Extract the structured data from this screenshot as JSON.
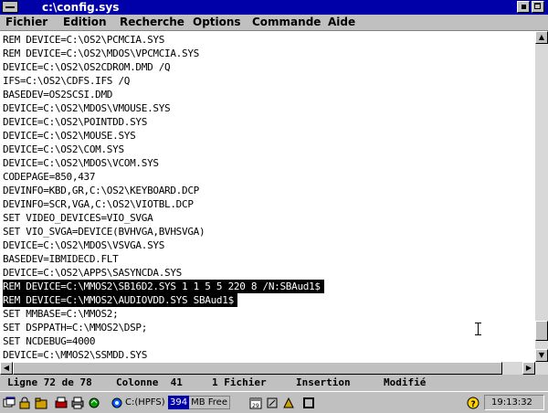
{
  "window": {
    "title": "c:\\config.sys"
  },
  "menubar": {
    "items": [
      {
        "label": "Fichier"
      },
      {
        "label": "Edition"
      },
      {
        "label": "Recherche"
      },
      {
        "label": "Options"
      },
      {
        "label": "Commande"
      },
      {
        "label": "Aide"
      }
    ]
  },
  "editor": {
    "lines": [
      {
        "text": "REM DEVICE=C:\\OS2\\PCMCIA.SYS",
        "selected": false
      },
      {
        "text": "REM DEVICE=C:\\OS2\\MDOS\\VPCMCIA.SYS",
        "selected": false
      },
      {
        "text": "DEVICE=C:\\OS2\\OS2CDROM.DMD /Q",
        "selected": false
      },
      {
        "text": "IFS=C:\\OS2\\CDFS.IFS /Q",
        "selected": false
      },
      {
        "text": "BASEDEV=OS2SCSI.DMD",
        "selected": false
      },
      {
        "text": "DEVICE=C:\\OS2\\MDOS\\VMOUSE.SYS",
        "selected": false
      },
      {
        "text": "DEVICE=C:\\OS2\\POINTDD.SYS",
        "selected": false
      },
      {
        "text": "DEVICE=C:\\OS2\\MOUSE.SYS",
        "selected": false
      },
      {
        "text": "DEVICE=C:\\OS2\\COM.SYS",
        "selected": false
      },
      {
        "text": "DEVICE=C:\\OS2\\MDOS\\VCOM.SYS",
        "selected": false
      },
      {
        "text": "CODEPAGE=850,437",
        "selected": false
      },
      {
        "text": "DEVINFO=KBD,GR,C:\\OS2\\KEYBOARD.DCP",
        "selected": false
      },
      {
        "text": "DEVINFO=SCR,VGA,C:\\OS2\\VIOTBL.DCP",
        "selected": false
      },
      {
        "text": "SET VIDEO_DEVICES=VIO_SVGA",
        "selected": false
      },
      {
        "text": "SET VIO_SVGA=DEVICE(BVHVGA,BVHSVGA)",
        "selected": false
      },
      {
        "text": "DEVICE=C:\\OS2\\MDOS\\VSVGA.SYS",
        "selected": false
      },
      {
        "text": "BASEDEV=IBMIDECD.FLT",
        "selected": false
      },
      {
        "text": "DEVICE=C:\\OS2\\APPS\\SASYNCDA.SYS",
        "selected": false
      },
      {
        "text": "REM DEVICE=C:\\MMOS2\\SB16D2.SYS 1 1 5 5 220 8 /N:SBAud1$",
        "selected": true
      },
      {
        "text": "REM DEVICE=C:\\MMOS2\\AUDIOVDD.SYS SBAud1$",
        "selected": true
      },
      {
        "text": "SET MMBASE=C:\\MMOS2;",
        "selected": false
      },
      {
        "text": "SET DSPPATH=C:\\MMOS2\\DSP;",
        "selected": false
      },
      {
        "text": "SET NCDEBUG=4000",
        "selected": false
      },
      {
        "text": "DEVICE=C:\\MMOS2\\SSMDD.SYS",
        "selected": false
      }
    ],
    "vscroll_position": 0.97,
    "hscroll_position": 0.0,
    "hscroll_visible_fraction": 0.96
  },
  "status": {
    "line_info": "Ligne 72 de 78",
    "column_info": "Colonne  41",
    "files_info": "1 Fichier",
    "mode": "Insertion",
    "state": "Modifié"
  },
  "taskbar": {
    "drive": "C:(HPFS)",
    "free_value": "394",
    "free_unit": "MB Free",
    "clock": "19:13:32",
    "icons": [
      "window-list-icon",
      "lock-icon",
      "folder-icon",
      "shredder-icon",
      "printer-icon",
      "refresh-icon",
      "dial-icon",
      "drive-icon",
      "calendar-icon",
      "tools-icon",
      "drives-icon",
      "help-icon"
    ]
  }
}
